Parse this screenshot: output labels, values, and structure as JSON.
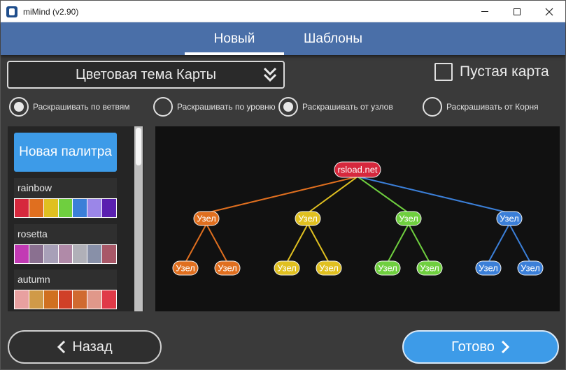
{
  "window": {
    "title": "miMind (v2.90)"
  },
  "tabs": [
    {
      "label": "Новый",
      "active": true
    },
    {
      "label": "Шаблоны",
      "active": false
    }
  ],
  "theme_select": {
    "label": "Цветовая тема Карты"
  },
  "empty_map": {
    "label": "Пустая карта",
    "checked": false
  },
  "coloring_options": [
    {
      "label": "Раскрашивать по ветвям",
      "checked": true
    },
    {
      "label": "Раскрашивать по уровню",
      "checked": false
    },
    {
      "label": "Раскрашивать от узлов",
      "checked": true
    },
    {
      "label": "Раскрашивать от Корня",
      "checked": false
    }
  ],
  "palette_list": {
    "new_palette_label": "Новая палитра",
    "palettes": [
      {
        "name": "rainbow",
        "colors": [
          "#d6283d",
          "#e06f1f",
          "#e0c020",
          "#6fcf3f",
          "#3b7fd8",
          "#9b86e8",
          "#5a20b0"
        ]
      },
      {
        "name": "rosetta",
        "colors": [
          "#c23ab4",
          "#8a7090",
          "#a8a0b8",
          "#b08aa8",
          "#b0b0b8",
          "#8890a8",
          "#a85868"
        ]
      },
      {
        "name": "autumn",
        "colors": [
          "#e8a0a0",
          "#d09a48",
          "#d07020",
          "#d04028",
          "#d06a30",
          "#e0988a",
          "#e03a48"
        ]
      }
    ]
  },
  "preview": {
    "root": {
      "label": "rsload.net",
      "color": "#d6283d"
    },
    "branches": [
      {
        "color": "#e06f1f",
        "label": "Узел",
        "children": [
          "Узел",
          "Узел"
        ]
      },
      {
        "color": "#e0c020",
        "label": "Узел",
        "children": [
          "Узел",
          "Узел"
        ]
      },
      {
        "color": "#6fcf3f",
        "label": "Узел",
        "children": [
          "Узел",
          "Узел"
        ]
      },
      {
        "color": "#3b7fd8",
        "label": "Узел",
        "children": [
          "Узел",
          "Узел"
        ]
      }
    ]
  },
  "buttons": {
    "back_label": "Назад",
    "done_label": "Готово"
  },
  "colors": {
    "accent": "#3d9be8",
    "header": "#4a6fa8"
  }
}
